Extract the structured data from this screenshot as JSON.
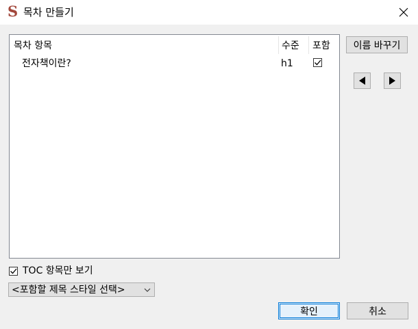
{
  "window": {
    "title": "목차 만들기",
    "logo_glyph": "S"
  },
  "toc_table": {
    "columns": {
      "item": "목차 항목",
      "level": "수준",
      "include": "포함"
    },
    "rows": [
      {
        "item": "전자책이란?",
        "level": "h1",
        "include": true
      }
    ]
  },
  "side_buttons": {
    "rename": "이름 바꾸기",
    "outdent": "◀",
    "indent": "▶"
  },
  "toc_only": {
    "label": "TOC 항목만 보기",
    "checked": true
  },
  "style_select": {
    "value": "<포함할 제목 스타일 선택>"
  },
  "footer": {
    "ok": "확인",
    "cancel": "취소"
  },
  "colors": {
    "logo": "#a2473b",
    "accent": "#0078d7",
    "list_border": "#828790"
  }
}
